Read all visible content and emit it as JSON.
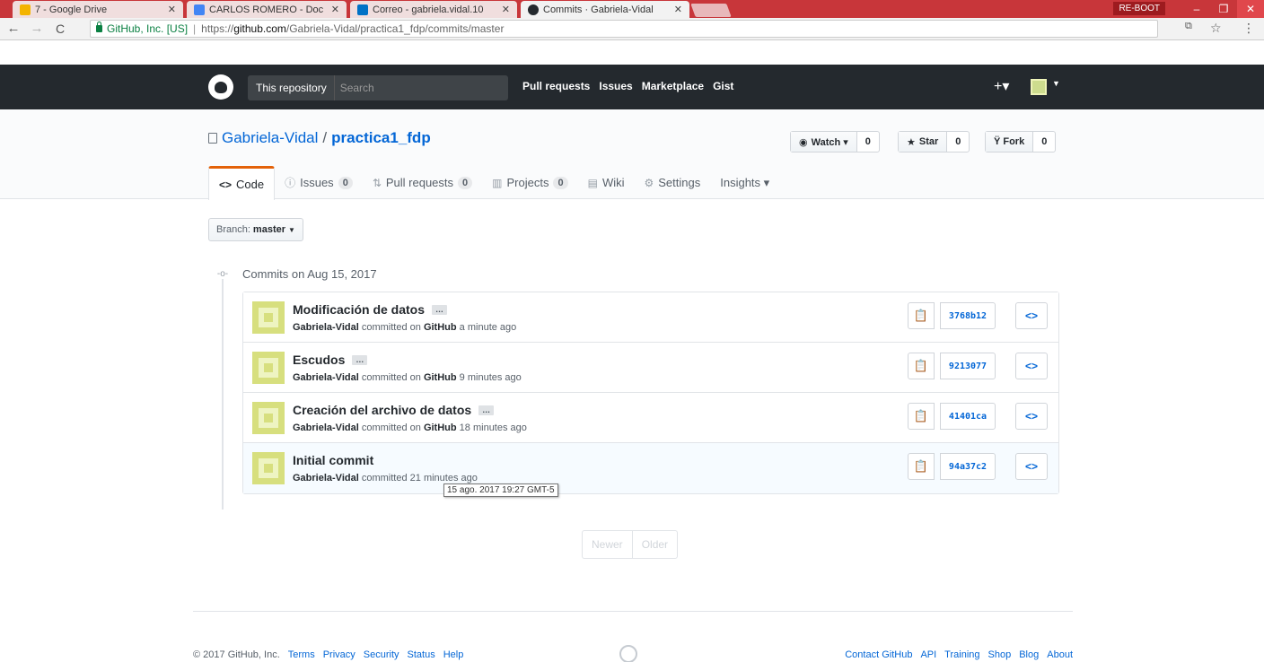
{
  "browser": {
    "tabs": [
      {
        "label": "7 - Google Drive",
        "icon_color": "#f4b400",
        "active": false
      },
      {
        "label": "CARLOS ROMERO - Doc",
        "icon_color": "#4285f4",
        "active": false
      },
      {
        "label": "Correo - gabriela.vidal.10",
        "icon_color": "#0072c6",
        "active": false
      },
      {
        "label": "Commits · Gabriela-Vidal",
        "icon_color": "#24292e",
        "active": true
      }
    ],
    "reboot_label": "RE-BOOT",
    "window_controls": {
      "minimize": "–",
      "restore": "❐",
      "close": "✕"
    },
    "address": {
      "secure_label": "GitHub, Inc. [US]",
      "url_scheme": "https://",
      "url_host": "github.com",
      "url_path": "/Gabriela-Vidal/practica1_fdp/commits/master"
    }
  },
  "header": {
    "search_scope": "This repository",
    "search_placeholder": "Search",
    "nav": [
      "Pull requests",
      "Issues",
      "Marketplace",
      "Gist"
    ],
    "plus": "+▾"
  },
  "repo": {
    "owner": "Gabriela-Vidal",
    "separator": "/",
    "name": "practica1_fdp",
    "watch": {
      "label": "Watch ▾",
      "count": "0"
    },
    "star": {
      "label": "Star",
      "count": "0"
    },
    "fork": {
      "label": "Fork",
      "count": "0"
    },
    "tabs": [
      {
        "icon": "<>",
        "label": "Code",
        "counter": ""
      },
      {
        "icon": "ⓘ",
        "label": "Issues",
        "counter": "0"
      },
      {
        "icon": "⇅",
        "label": "Pull requests",
        "counter": "0"
      },
      {
        "icon": "▥",
        "label": "Projects",
        "counter": "0"
      },
      {
        "icon": "▤",
        "label": "Wiki",
        "counter": ""
      },
      {
        "icon": "⚙",
        "label": "Settings",
        "counter": ""
      },
      {
        "icon": "",
        "label": "Insights ▾",
        "counter": ""
      }
    ]
  },
  "branch": {
    "prefix": "Branch:",
    "name": "master"
  },
  "commits_group": {
    "date_label": "Commits on Aug 15, 2017",
    "commits": [
      {
        "message": "Modificación de datos",
        "author": "Gabriela-Vidal",
        "verb": "committed on",
        "platform": "GitHub",
        "time": "a minute ago",
        "sha": "3768b12"
      },
      {
        "message": "Escudos",
        "author": "Gabriela-Vidal",
        "verb": "committed on",
        "platform": "GitHub",
        "time": "9 minutes ago",
        "sha": "9213077"
      },
      {
        "message": "Creación del archivo de datos",
        "author": "Gabriela-Vidal",
        "verb": "committed on",
        "platform": "GitHub",
        "time": "18 minutes ago",
        "sha": "41401ca"
      },
      {
        "message": "Initial commit",
        "author": "Gabriela-Vidal",
        "verb": "committed",
        "platform": "",
        "time": "21 minutes ago",
        "sha": "94a37c2"
      }
    ],
    "ellipsis": "…",
    "browse_icon": "<>",
    "tooltip": "15 ago. 2017 19:27 GMT-5"
  },
  "pager": {
    "newer": "Newer",
    "older": "Older"
  },
  "footer": {
    "copyright": "© 2017 GitHub, Inc.",
    "left_links": [
      "Terms",
      "Privacy",
      "Security",
      "Status",
      "Help"
    ],
    "right_links": [
      "Contact GitHub",
      "API",
      "Training",
      "Shop",
      "Blog",
      "About"
    ]
  }
}
